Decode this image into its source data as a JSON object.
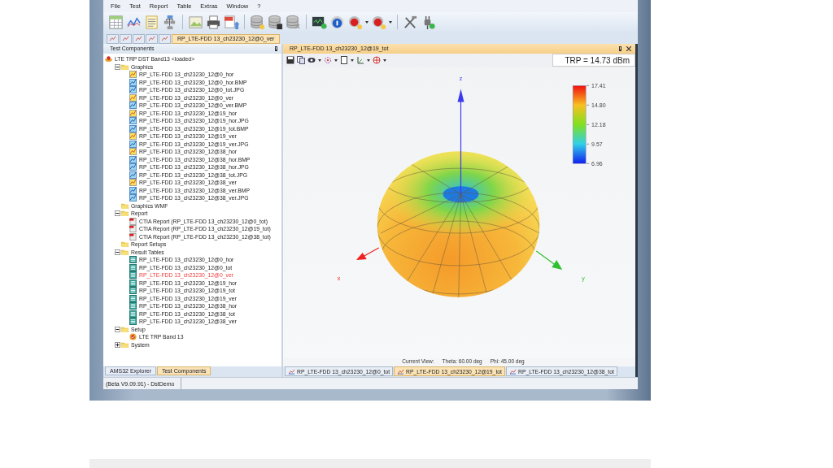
{
  "menu": [
    "File",
    "Test",
    "Report",
    "Table",
    "Extras",
    "Window",
    "?"
  ],
  "doc_tabs": [
    {
      "kind": "icon",
      "selected": false
    },
    {
      "kind": "icon",
      "selected": false
    },
    {
      "kind": "icon",
      "selected": false
    },
    {
      "kind": "icon",
      "selected": false
    },
    {
      "kind": "icon",
      "selected": false
    },
    {
      "kind": "labeled",
      "label": "RP_LTE-FDD 13_ch23230_12@0_ver",
      "selected": true
    }
  ],
  "left_panel": {
    "title": "Test Components",
    "tree": [
      {
        "label": "LTE TRP DST Band13 <loaded>",
        "kind": "project",
        "children": [
          {
            "label": "Graphics",
            "kind": "folder",
            "expanded": true,
            "children": [
              {
                "label": "RP_LTE-FDD 13_ch23230_12@0_hor",
                "kind": "graph"
              },
              {
                "label": "RP_LTE-FDD 13_ch23230_12@0_hor.BMP",
                "kind": "image"
              },
              {
                "label": "RP_LTE-FDD 13_ch23230_12@0_tot.JPG",
                "kind": "image"
              },
              {
                "label": "RP_LTE-FDD 13_ch23230_12@0_ver",
                "kind": "graph"
              },
              {
                "label": "RP_LTE-FDD 13_ch23230_12@0_ver.BMP",
                "kind": "image"
              },
              {
                "label": "RP_LTE-FDD 13_ch23230_12@19_hor",
                "kind": "graph"
              },
              {
                "label": "RP_LTE-FDD 13_ch23230_12@19_hor.JPG",
                "kind": "image"
              },
              {
                "label": "RP_LTE-FDD 13_ch23230_12@19_tot.BMP",
                "kind": "image"
              },
              {
                "label": "RP_LTE-FDD 13_ch23230_12@19_ver",
                "kind": "graph"
              },
              {
                "label": "RP_LTE-FDD 13_ch23230_12@19_ver.JPG",
                "kind": "image"
              },
              {
                "label": "RP_LTE-FDD 13_ch23230_12@38_hor",
                "kind": "graph"
              },
              {
                "label": "RP_LTE-FDD 13_ch23230_12@38_hor.BMP",
                "kind": "image"
              },
              {
                "label": "RP_LTE-FDD 13_ch23230_12@38_hor.JPG",
                "kind": "image"
              },
              {
                "label": "RP_LTE-FDD 13_ch23230_12@38_tot.JPG",
                "kind": "image"
              },
              {
                "label": "RP_LTE-FDD 13_ch23230_12@38_ver",
                "kind": "graph"
              },
              {
                "label": "RP_LTE-FDD 13_ch23230_12@38_ver.BMP",
                "kind": "image"
              },
              {
                "label": "RP_LTE-FDD 13_ch23230_12@38_ver.JPG",
                "kind": "image"
              }
            ]
          },
          {
            "label": "Graphics WMF",
            "kind": "folder"
          },
          {
            "label": "Report",
            "kind": "folder",
            "expanded": true,
            "children": [
              {
                "label": "CTIA Report (RP_LTE-FDD 13_ch23230_12@0_tot)",
                "kind": "report"
              },
              {
                "label": "CTIA Report (RP_LTE-FDD 13_ch23230_12@19_tot)",
                "kind": "report"
              },
              {
                "label": "CTIA Report (RP_LTE-FDD 13_ch23230_12@38_tot)",
                "kind": "report"
              }
            ]
          },
          {
            "label": "Report Setups",
            "kind": "folder"
          },
          {
            "label": "Result Tables",
            "kind": "folder",
            "expanded": true,
            "children": [
              {
                "label": "RP_LTE-FDD 13_ch23230_12@0_hor",
                "kind": "table",
                "highlighted": false
              },
              {
                "label": "RP_LTE-FDD 13_ch23230_12@0_tot",
                "kind": "table",
                "highlighted": false
              },
              {
                "label": "RP_LTE-FDD 13_ch23230_12@0_ver",
                "kind": "table",
                "highlighted": true
              },
              {
                "label": "RP_LTE-FDD 13_ch23230_12@19_hor",
                "kind": "table",
                "highlighted": false
              },
              {
                "label": "RP_LTE-FDD 13_ch23230_12@19_tot",
                "kind": "table",
                "highlighted": false
              },
              {
                "label": "RP_LTE-FDD 13_ch23230_12@19_ver",
                "kind": "table",
                "highlighted": false
              },
              {
                "label": "RP_LTE-FDD 13_ch23230_12@38_hor",
                "kind": "table",
                "highlighted": false
              },
              {
                "label": "RP_LTE-FDD 13_ch23230_12@38_tot",
                "kind": "table",
                "highlighted": false
              },
              {
                "label": "RP_LTE-FDD 13_ch23230_12@38_ver",
                "kind": "table",
                "highlighted": false
              }
            ]
          },
          {
            "label": "Setup",
            "kind": "folder",
            "expanded": true,
            "children": [
              {
                "label": "LTE TRP Band 13",
                "kind": "setup"
              }
            ]
          },
          {
            "label": "System",
            "kind": "folder",
            "expanded": false
          }
        ]
      }
    ],
    "tabs": [
      {
        "label": "AMS32 Explorer",
        "selected": false
      },
      {
        "label": "Test Components",
        "selected": true
      }
    ]
  },
  "view": {
    "title": "RP_LTE-FDD 13_ch23230_12@19_tot",
    "trp": "TRP = 14.73 dBm",
    "axis_labels": {
      "z": "z",
      "x": "x",
      "y": "y"
    },
    "colorbar_ticks": [
      "17.41",
      "14.80",
      "12.18",
      "9.57",
      "6.96"
    ],
    "current_view": {
      "label": "Current View:",
      "theta": "Theta: 60.00 deg",
      "phi": "Phi: 45.00 deg"
    },
    "tabs": [
      {
        "label": "RP_LTE-FDD 13_ch23230_12@0_tot",
        "selected": false
      },
      {
        "label": "RP_LTE-FDD 13_ch23230_12@19_tot",
        "selected": true
      },
      {
        "label": "RP_LTE-FDD 13_ch23230_12@38_tot",
        "selected": false
      }
    ]
  },
  "status_bar": "(Beta V9.09.91) - DstDemo"
}
